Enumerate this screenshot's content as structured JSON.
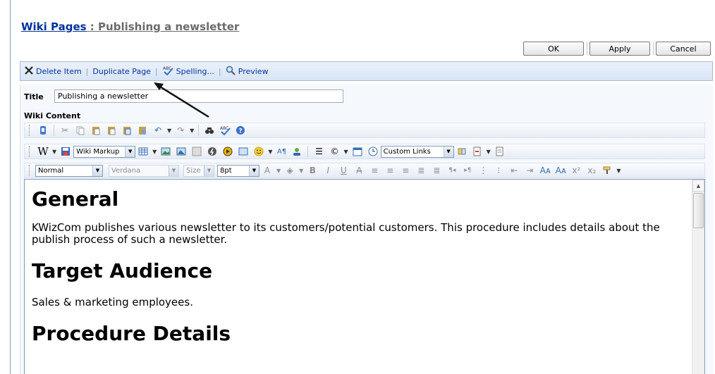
{
  "header": {
    "section_link": "Wiki Pages",
    "separator": " : ",
    "page_name": "Publishing a newsletter"
  },
  "buttons": {
    "ok": "OK",
    "apply": "Apply",
    "cancel": "Cancel"
  },
  "command_bar": {
    "delete": "Delete Item",
    "duplicate": "Duplicate Page",
    "spelling": "Spelling...",
    "preview": "Preview",
    "pipe": "|"
  },
  "fields": {
    "title_label": "Title",
    "title_value": "Publishing a newsletter",
    "wiki_content_label": "Wiki Content"
  },
  "toolbar": {
    "markup_select": "Wiki Markup",
    "links_select": "Custom Links",
    "style_select": "Normal",
    "font_select": "Verdana",
    "size_label": "Size",
    "size_select": "8pt"
  },
  "editor": {
    "heading_general": "General",
    "para_general": "KWizCom publishes various newsletter to its customers/potential customers. This procedure includes details about the publish process of such a newsletter.",
    "heading_audience": "Target Audience",
    "para_audience": "Sales & marketing employees.",
    "heading_procedure": "Procedure Details"
  },
  "colors": {
    "link": "#003399",
    "toolbar_bg": "#d9e5f6",
    "border": "#7f9db9"
  }
}
